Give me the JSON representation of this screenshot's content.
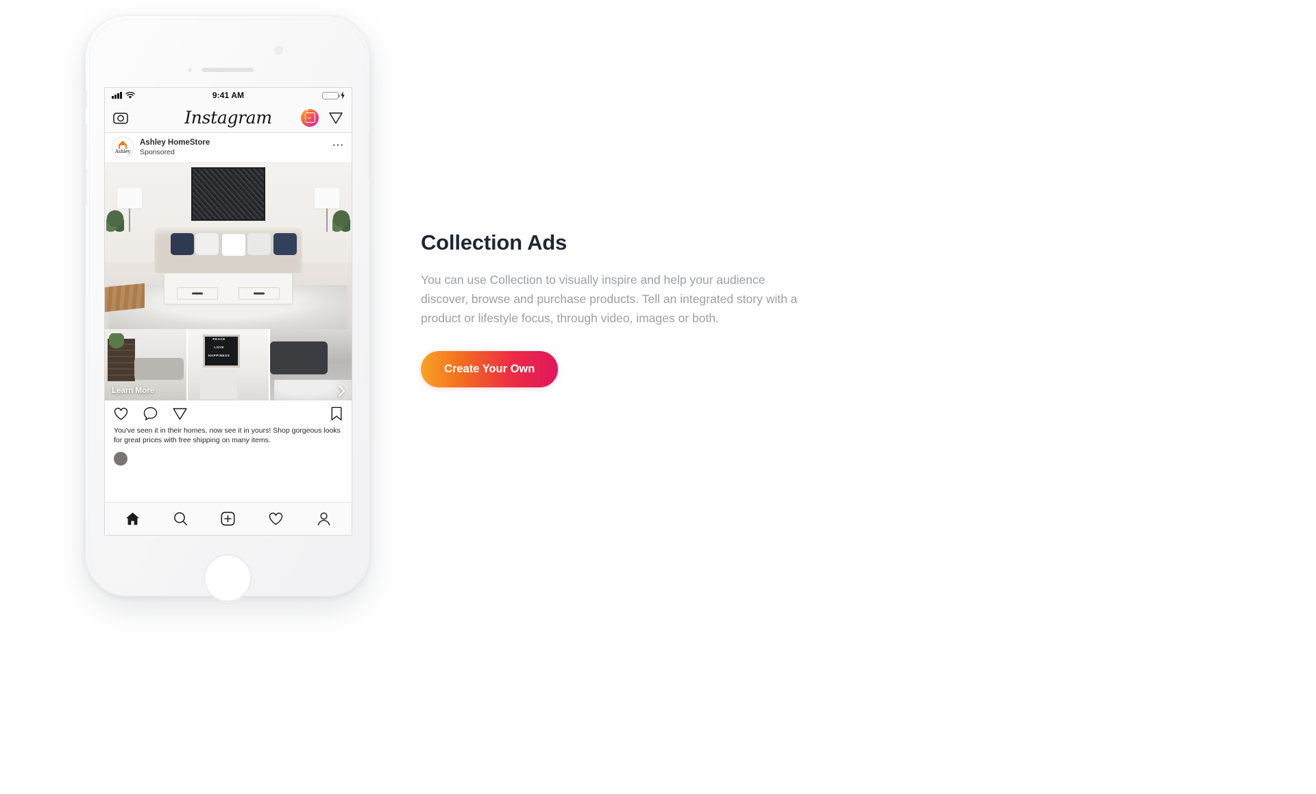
{
  "phone": {
    "status_bar": {
      "time": "9:41 AM",
      "signal_icon": "cellular-bars-icon",
      "wifi_icon": "wifi-icon",
      "battery_icon": "battery-icon",
      "charging_icon": "lightning-bolt-icon",
      "battery_color": "#4cd964"
    },
    "app_header": {
      "camera_icon": "camera-icon",
      "logo_text": "Instagram",
      "igtv_icon": "igtv-icon",
      "direct_icon": "paper-plane-icon"
    },
    "post": {
      "avatar_icon": "ashley-homestore-avatar",
      "avatar_wordmark": "Ashley",
      "brand_name": "Ashley HomeStore",
      "sponsored_label": "Sponsored",
      "more_options_icon": "more-options-icon",
      "cta_overlay": "Learn More",
      "carousel_next_icon": "chevron-right-icon",
      "thumbnail_text": [
        "PEACE",
        "LOVE",
        "HAPPINESS"
      ],
      "caption": "You've seen it in their homes, now see it in yours! Shop gorgeous looks for great prices with free shipping on many items.",
      "actions": {
        "like_icon": "heart-icon",
        "comment_icon": "comment-bubble-icon",
        "share_icon": "paper-plane-icon",
        "save_icon": "bookmark-icon"
      }
    },
    "bottom_nav": {
      "home_icon": "home-icon",
      "search_icon": "search-icon",
      "add_icon": "plus-square-icon",
      "activity_icon": "heart-icon",
      "profile_icon": "person-icon"
    }
  },
  "panel": {
    "title": "Collection Ads",
    "description": "You can use Collection to visually inspire and help your audience discover, browse and purchase products. Tell an integrated story with a product or lifestyle focus, through video, images or both.",
    "cta_label": "Create Your Own",
    "cta_gradient_start": "#f7a325",
    "cta_gradient_end": "#e0175e",
    "title_color": "#1f2733",
    "description_color": "#9ba0a6"
  }
}
